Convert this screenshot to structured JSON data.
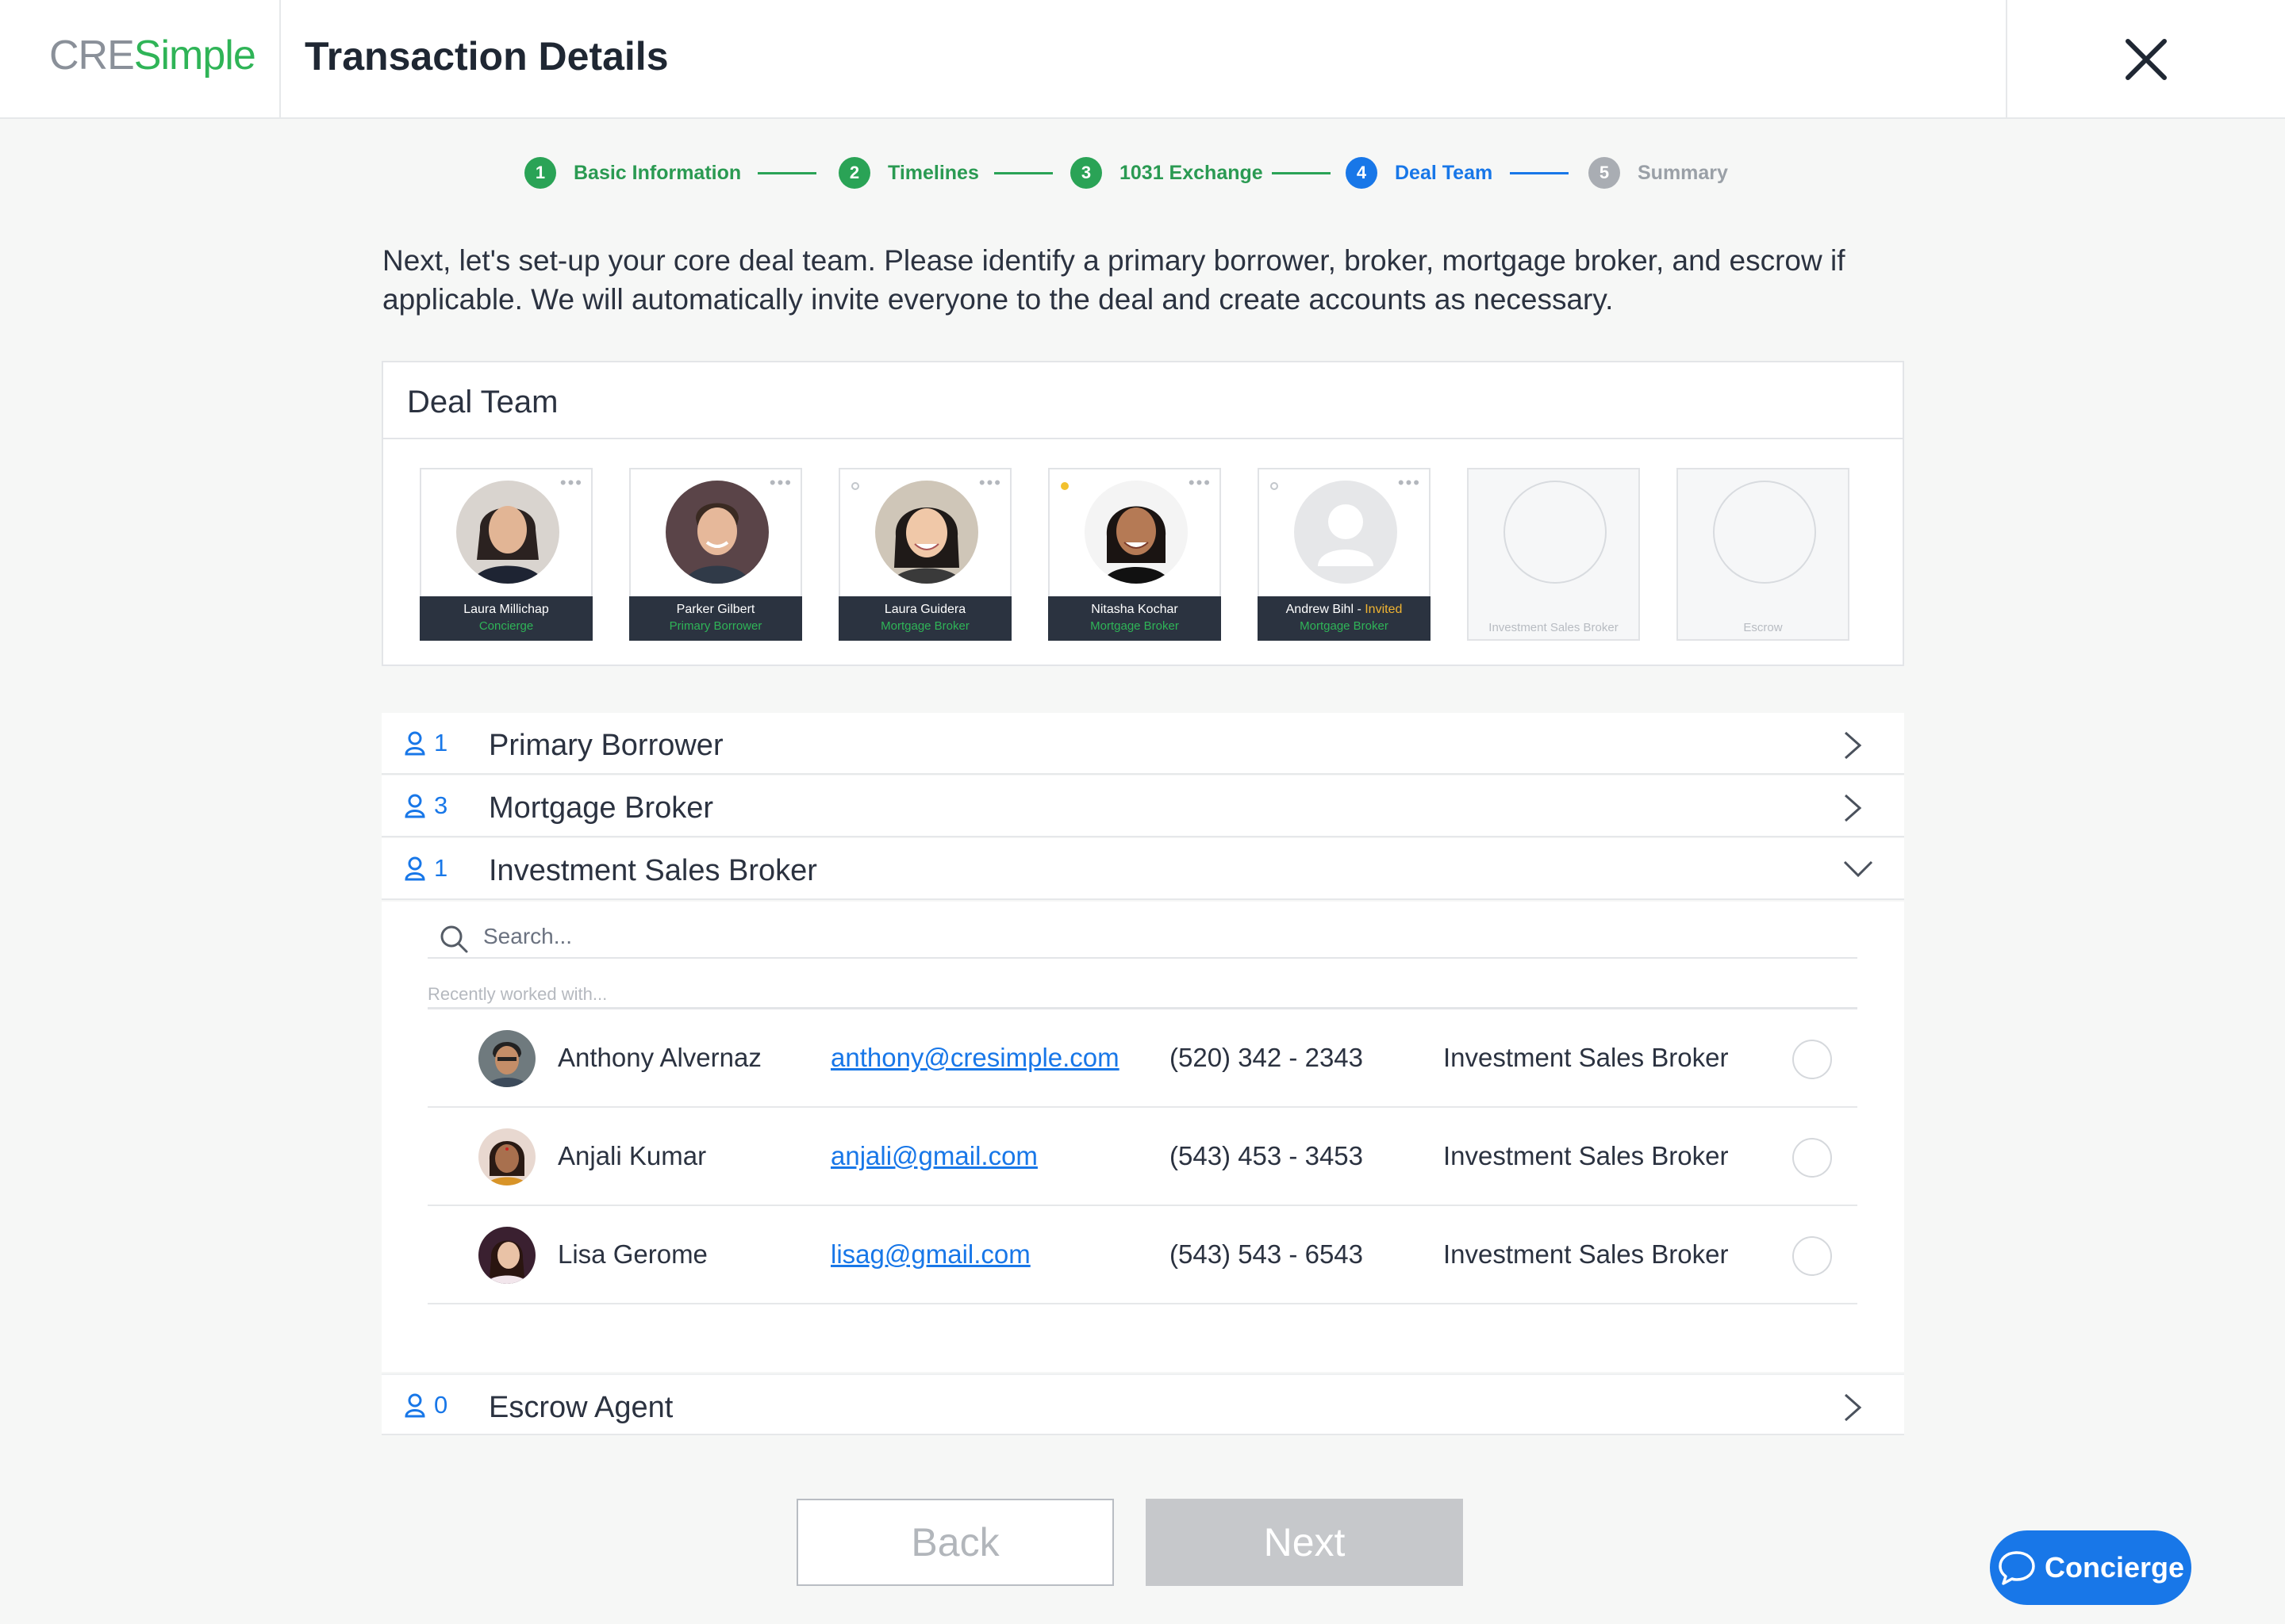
{
  "app": {
    "logo_cre": "CRE",
    "logo_simple": "Simple",
    "title": "Transaction Details"
  },
  "stepper": [
    {
      "num": "1",
      "label": "Basic Information",
      "state": "done"
    },
    {
      "num": "2",
      "label": "Timelines",
      "state": "done"
    },
    {
      "num": "3",
      "label": "1031 Exchange",
      "state": "done"
    },
    {
      "num": "4",
      "label": "Deal Team",
      "state": "active"
    },
    {
      "num": "5",
      "label": "Summary",
      "state": "todo"
    }
  ],
  "intro": "Next, let's set-up your core deal team. Please identify a primary borrower, broker, mortgage broker, and escrow if applicable. We will automatically invite everyone to the deal and create accounts as necessary.",
  "deal_team": {
    "title": "Deal Team",
    "members": [
      {
        "name": "Laura Millichap",
        "role": "Concierge"
      },
      {
        "name": "Parker Gilbert",
        "role": "Primary Borrower"
      },
      {
        "name": "Laura Guidera",
        "role": "Mortgage Broker"
      },
      {
        "name": "Nitasha Kochar",
        "role": "Mortgage Broker"
      },
      {
        "name": "Andrew Bihl",
        "invited": "Invited",
        "role": "Mortgage Broker"
      }
    ],
    "empty_slots": [
      "Investment Sales Broker",
      "Escrow"
    ]
  },
  "sections": [
    {
      "count": "1",
      "title": "Primary Borrower"
    },
    {
      "count": "3",
      "title": "Mortgage Broker"
    },
    {
      "count": "1",
      "title": "Investment Sales Broker"
    },
    {
      "count": "0",
      "title": "Escrow Agent"
    }
  ],
  "search": {
    "placeholder": "Search...",
    "recent_label": "Recently worked with..."
  },
  "people": [
    {
      "name": "Anthony Alvernaz",
      "email": "anthony@cresimple.com",
      "phone": "(520) 342 - 2343",
      "role": "Investment Sales Broker"
    },
    {
      "name": "Anjali Kumar",
      "email": "anjali@gmail.com",
      "phone": "(543) 453 - 3453",
      "role": "Investment Sales Broker"
    },
    {
      "name": "Lisa Gerome",
      "email": "lisag@gmail.com",
      "phone": "(543) 543 - 6543",
      "role": "Investment Sales Broker"
    }
  ],
  "buttons": {
    "back": "Back",
    "next": "Next",
    "concierge": "Concierge"
  },
  "colors": {
    "brand_green": "#2fb457",
    "accent_blue": "#1877e8",
    "done_green": "#2aa356",
    "nameplate": "#2b3340"
  }
}
